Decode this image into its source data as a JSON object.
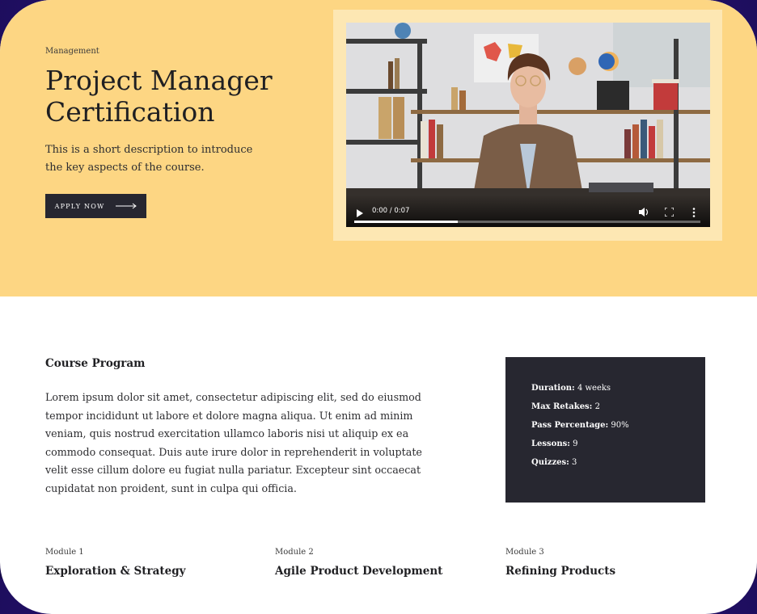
{
  "hero": {
    "category": "Management",
    "title": "Project Manager Certification",
    "description": "This is a short description to introduce the key aspects of the course.",
    "apply_label": "APPLY NOW",
    "colors": {
      "background": "#fdd683",
      "button": "#272730"
    }
  },
  "video": {
    "time": "0:00 / 0:07",
    "progress_fraction": 0.3,
    "icons": [
      "play-icon",
      "volume-icon",
      "fullscreen-icon",
      "more-options-icon"
    ]
  },
  "program": {
    "heading": "Course Program",
    "body": "Lorem ipsum dolor sit amet, consectetur adipiscing elit, sed do eiusmod tempor incididunt ut labore et dolore magna aliqua. Ut enim ad minim veniam, quis nostrud exercitation ullamco laboris nisi ut aliquip ex ea commodo consequat. Duis aute irure dolor in reprehenderit in voluptate velit esse cillum dolore eu fugiat nulla pariatur. Excepteur sint occaecat cupidatat non proident, sunt in culpa qui officia."
  },
  "stats": [
    {
      "label": "Duration:",
      "value": "4 weeks"
    },
    {
      "label": "Max Retakes:",
      "value": "2"
    },
    {
      "label": "Pass Percentage:",
      "value": "90%"
    },
    {
      "label": "Lessons:",
      "value": "9"
    },
    {
      "label": "Quizzes:",
      "value": "3"
    }
  ],
  "modules": [
    {
      "label": "Module 1",
      "name": "Exploration & Strategy"
    },
    {
      "label": "Module 2",
      "name": "Agile Product Development"
    },
    {
      "label": "Module 3",
      "name": "Refining Products"
    }
  ]
}
